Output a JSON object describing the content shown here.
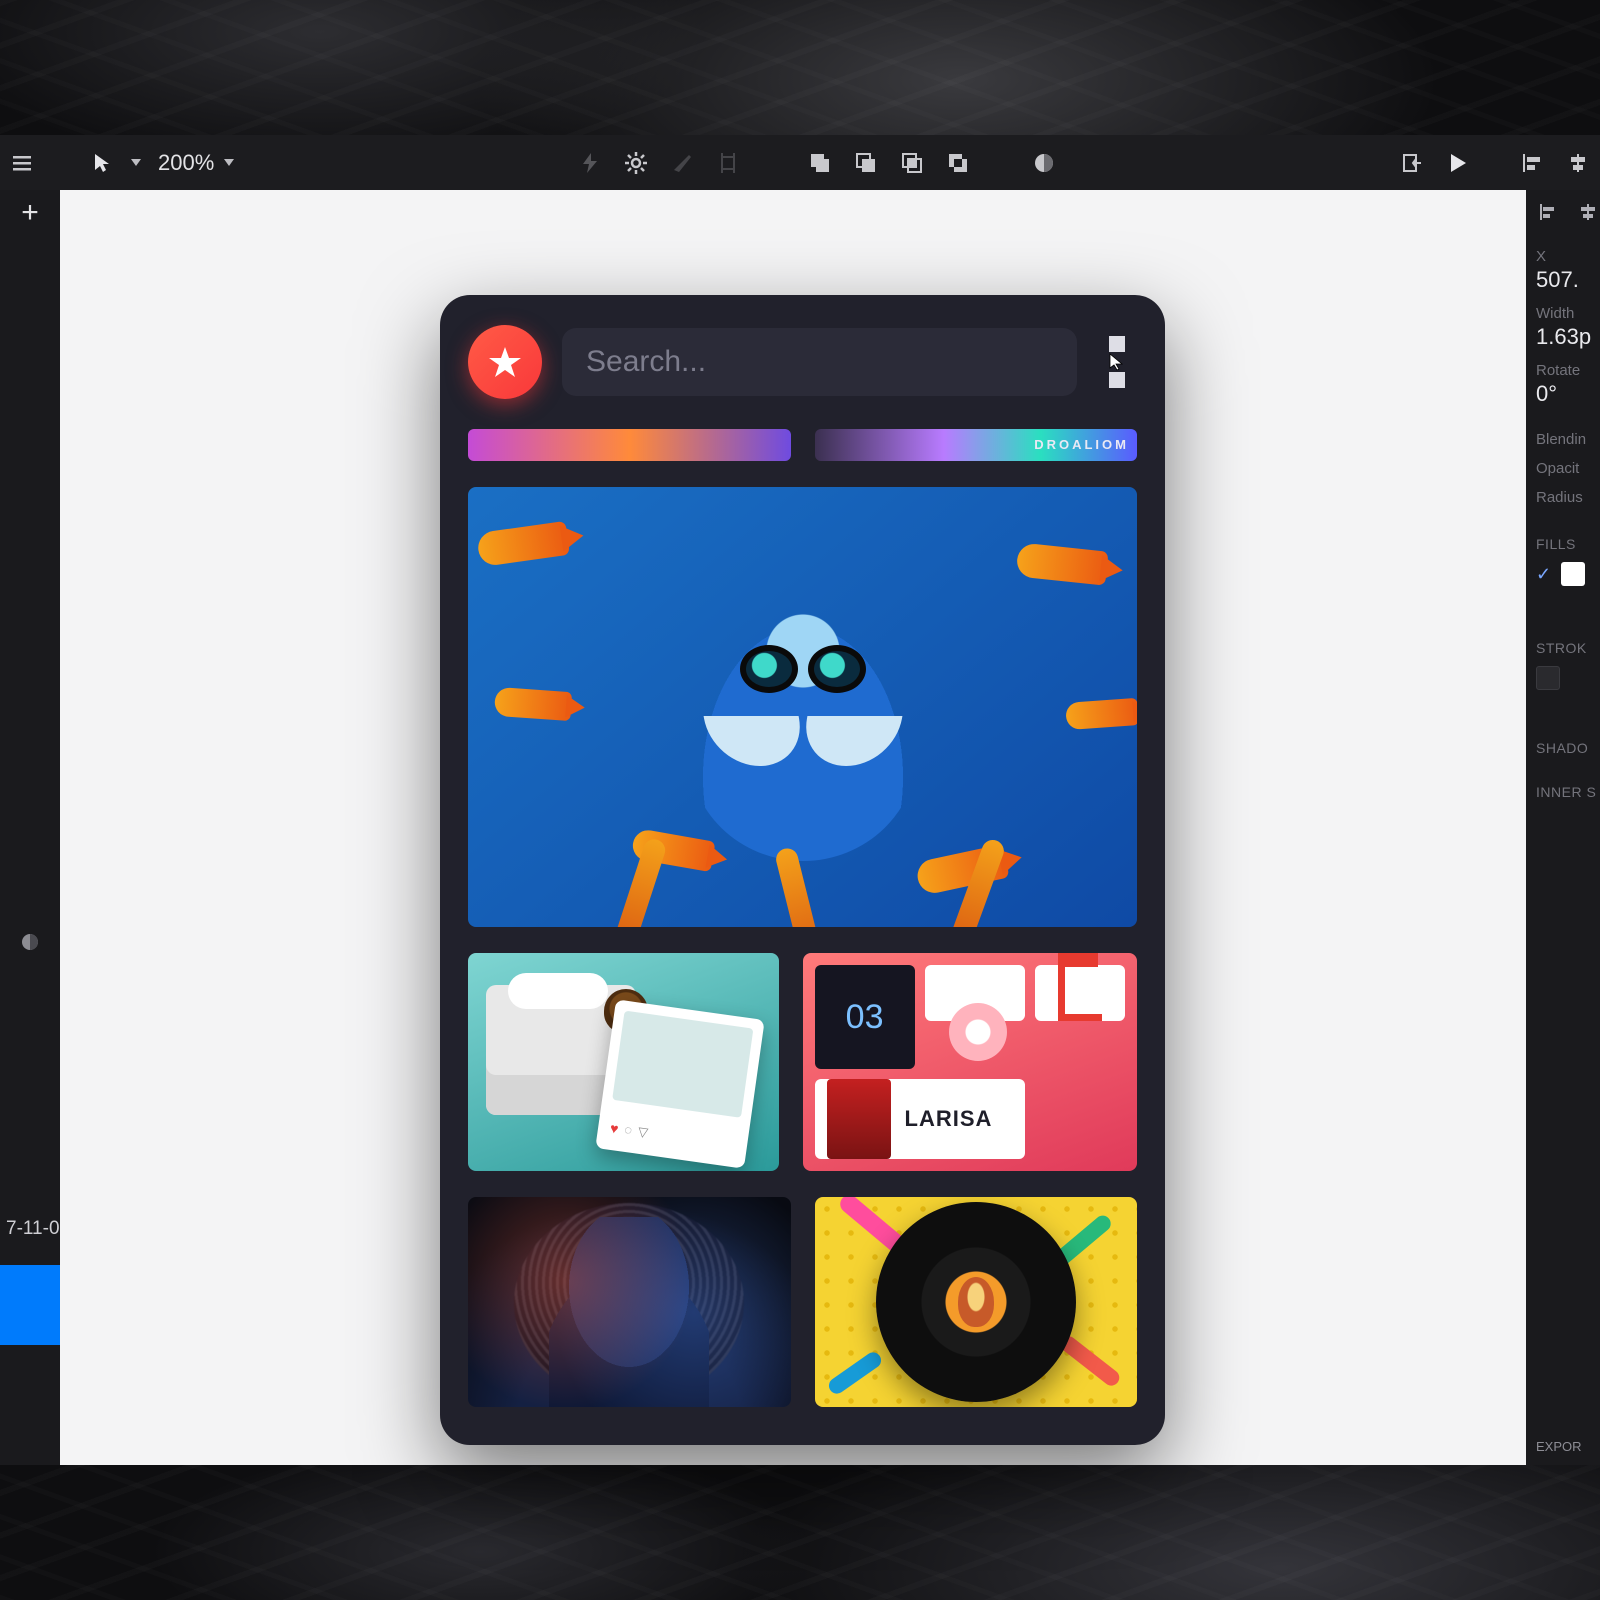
{
  "toolbar": {
    "zoom": "200%"
  },
  "leftbar": {
    "tab_label": "7-11-0..."
  },
  "inspector": {
    "x_label": "X",
    "x_value": "507.",
    "width_label": "Width",
    "width_value": "1.63p",
    "rotate_label": "Rotate",
    "rotate_value": "0°",
    "blending_label": "Blendin",
    "opacity_label": "Opacit",
    "radius_label": "Radius",
    "fills_label": "FILLS",
    "stroke_label": "STROK",
    "shadow_label": "SHADO",
    "inner_label": "INNER S",
    "export_label": "EXPOR"
  },
  "plugin": {
    "search_placeholder": "Search...",
    "strip2_text": "DROALIOM",
    "tile_b": {
      "portfolio_name": "LARISA",
      "dark_card_big": "03"
    }
  }
}
